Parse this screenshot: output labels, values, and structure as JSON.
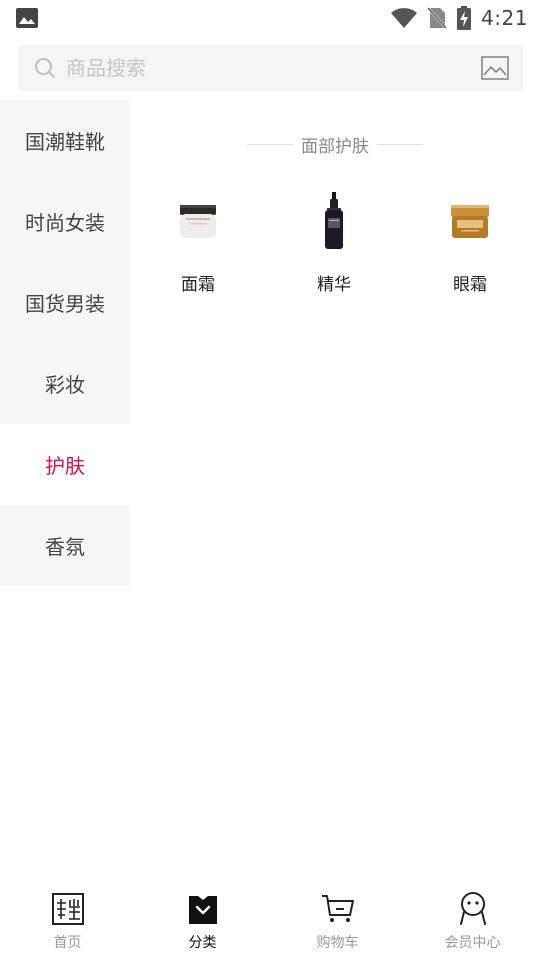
{
  "status_bar": {
    "time": "4:21",
    "icons": [
      "gallery-icon",
      "wifi-icon",
      "no-sim-icon",
      "battery-charging-icon"
    ]
  },
  "search": {
    "placeholder": "商品搜索",
    "icon": "search-icon",
    "image_search_icon": "image-search-icon"
  },
  "sidebar": {
    "items": [
      {
        "label": "国潮鞋靴"
      },
      {
        "label": "时尚女装"
      },
      {
        "label": "国货男装"
      },
      {
        "label": "彩妆"
      },
      {
        "label": "护肤",
        "active": true
      },
      {
        "label": "香氛"
      }
    ]
  },
  "content": {
    "section_title": "面部护肤",
    "products": [
      {
        "name": "面霜",
        "icon": "face-cream-jar-icon"
      },
      {
        "name": "精华",
        "icon": "serum-bottle-icon"
      },
      {
        "name": "眼霜",
        "icon": "eye-cream-jar-icon"
      }
    ]
  },
  "bottom_nav": {
    "items": [
      {
        "label": "首页",
        "icon": "home-logo-icon"
      },
      {
        "label": "分类",
        "icon": "category-icon",
        "active": true
      },
      {
        "label": "购物车",
        "icon": "cart-icon"
      },
      {
        "label": "会员中心",
        "icon": "member-icon"
      }
    ]
  },
  "colors": {
    "accent": "#e3104a",
    "sidebar_bg": "#f6f6f6",
    "search_bg": "#f5f5f5"
  }
}
